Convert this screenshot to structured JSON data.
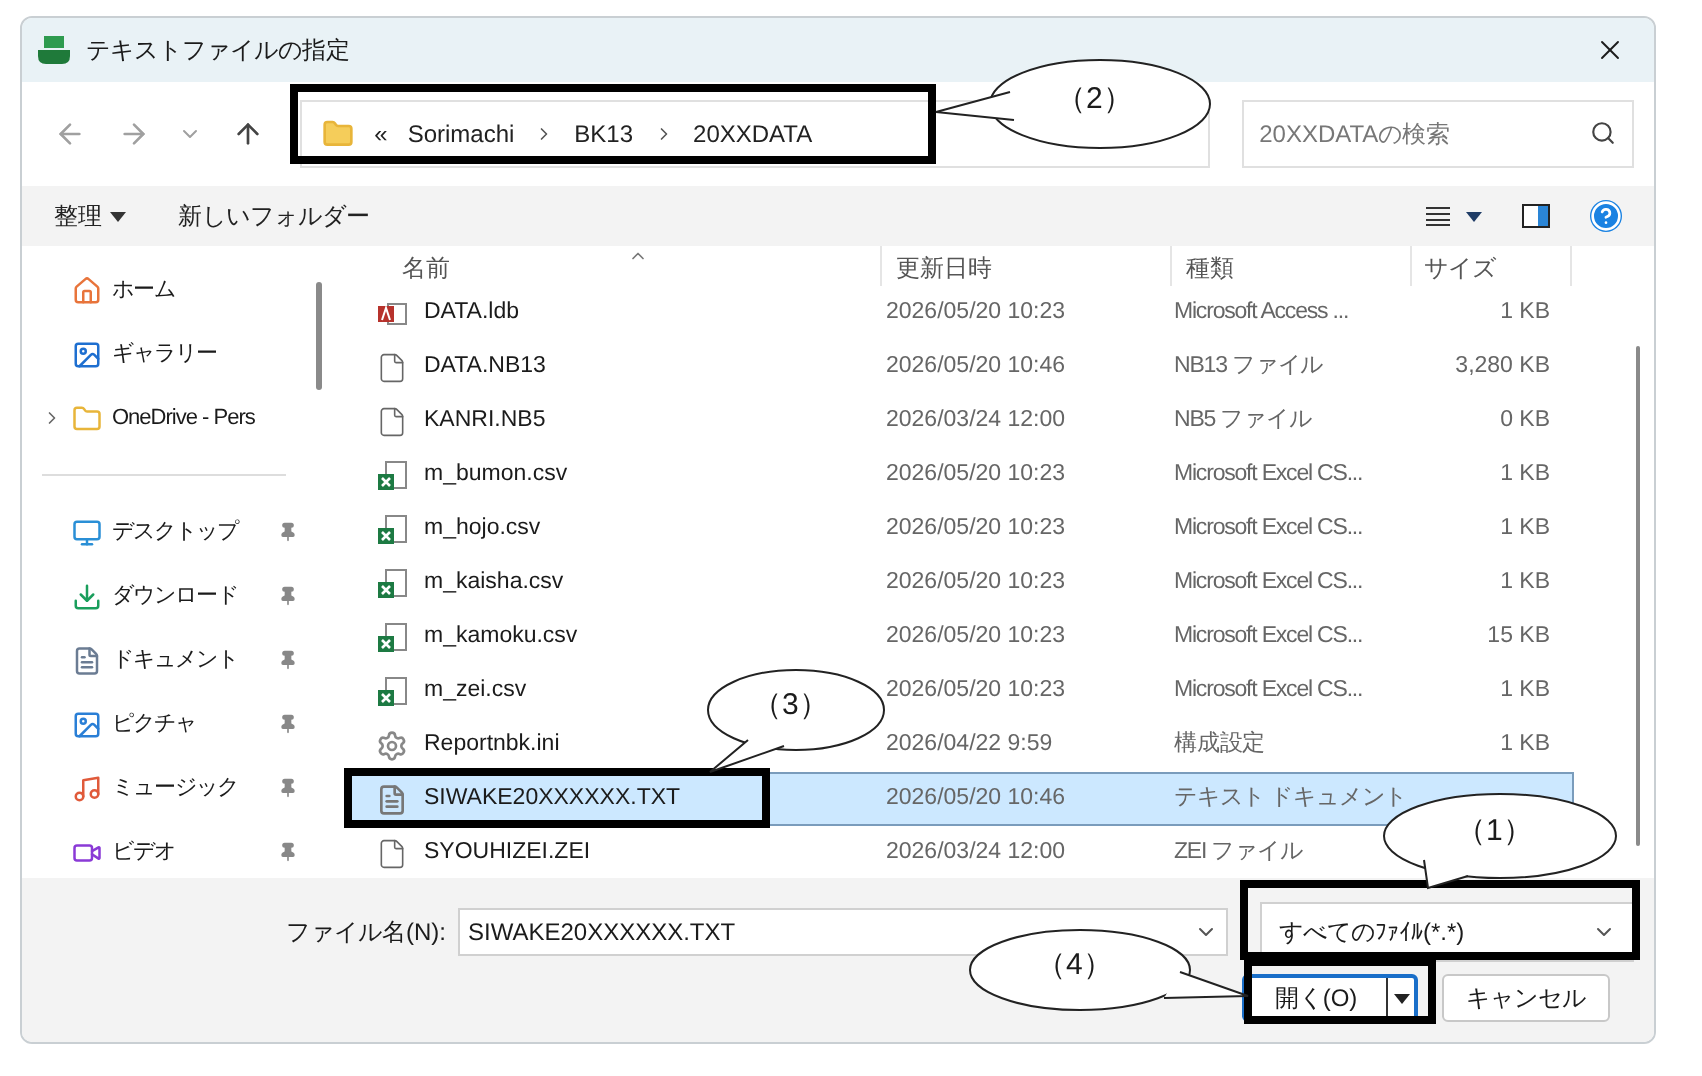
{
  "window": {
    "title": "テキストファイルの指定"
  },
  "address": {
    "crumbs": [
      "«",
      "Sorimachi",
      "BK13",
      "20XXDATA"
    ]
  },
  "search": {
    "placeholder": "20XXDATAの検索"
  },
  "toolbar": {
    "organize": "整理",
    "new_folder": "新しいフォルダー"
  },
  "sidebar": {
    "items": [
      {
        "label": "ホーム",
        "kind": "home",
        "pinned": false,
        "expandable": false
      },
      {
        "label": "ギャラリー",
        "kind": "gallery",
        "pinned": false,
        "expandable": false
      },
      {
        "label": "OneDrive - Pers",
        "kind": "folder",
        "pinned": false,
        "expandable": true
      },
      {
        "label": "デスクトップ",
        "kind": "desktop",
        "pinned": true,
        "expandable": false
      },
      {
        "label": "ダウンロード",
        "kind": "download",
        "pinned": true,
        "expandable": false
      },
      {
        "label": "ドキュメント",
        "kind": "documents",
        "pinned": true,
        "expandable": false
      },
      {
        "label": "ピクチャ",
        "kind": "pictures",
        "pinned": true,
        "expandable": false
      },
      {
        "label": "ミュージック",
        "kind": "music",
        "pinned": true,
        "expandable": false
      },
      {
        "label": "ビデオ",
        "kind": "video",
        "pinned": true,
        "expandable": false
      }
    ]
  },
  "table": {
    "columns": [
      "名前",
      "更新日時",
      "種類",
      "サイズ"
    ],
    "rows": [
      {
        "name": "DATA.ldb",
        "date": "2026/05/20 10:23",
        "type": "Microsoft Access ...",
        "size": "1 KB",
        "kind": "access",
        "selected": false
      },
      {
        "name": "DATA.NB13",
        "date": "2026/05/20 10:46",
        "type": "NB13 ファイル",
        "size": "3,280 KB",
        "kind": "file",
        "selected": false
      },
      {
        "name": "KANRI.NB5",
        "date": "2026/03/24 12:00",
        "type": "NB5 ファイル",
        "size": "0 KB",
        "kind": "file",
        "selected": false
      },
      {
        "name": "m_bumon.csv",
        "date": "2026/05/20 10:23",
        "type": "Microsoft Excel CS...",
        "size": "1 KB",
        "kind": "csv",
        "selected": false
      },
      {
        "name": "m_hojo.csv",
        "date": "2026/05/20 10:23",
        "type": "Microsoft Excel CS...",
        "size": "1 KB",
        "kind": "csv",
        "selected": false
      },
      {
        "name": "m_kaisha.csv",
        "date": "2026/05/20 10:23",
        "type": "Microsoft Excel CS...",
        "size": "1 KB",
        "kind": "csv",
        "selected": false
      },
      {
        "name": "m_kamoku.csv",
        "date": "2026/05/20 10:23",
        "type": "Microsoft Excel CS...",
        "size": "15 KB",
        "kind": "csv",
        "selected": false
      },
      {
        "name": "m_zei.csv",
        "date": "2026/05/20 10:23",
        "type": "Microsoft Excel CS...",
        "size": "1 KB",
        "kind": "csv",
        "selected": false
      },
      {
        "name": "Reportnbk.ini",
        "date": "2026/04/22 9:59",
        "type": "構成設定",
        "size": "1 KB",
        "kind": "ini",
        "selected": false
      },
      {
        "name": "SIWAKE20XXXXXX.TXT",
        "date": "2026/05/20 10:46",
        "type": "テキスト ドキュメント",
        "kind": "txt",
        "selected": true
      },
      {
        "name": "SYOUHIZEI.ZEI",
        "date": "2026/03/24 12:00",
        "type": "ZEI ファイル",
        "kind": "file",
        "selected": false
      }
    ]
  },
  "footer": {
    "filename_label": "ファイル名(N):",
    "filename": "SIWAKE20XXXXXX.TXT",
    "filetype": "すべてのﾌｧｲﾙ(*.*)",
    "open_button": "開く(O)",
    "cancel_button": "キャンセル"
  },
  "callouts": [
    {
      "label": "（2）"
    },
    {
      "label": "（3）"
    },
    {
      "label": "（1）"
    },
    {
      "label": "（4）"
    }
  ]
}
